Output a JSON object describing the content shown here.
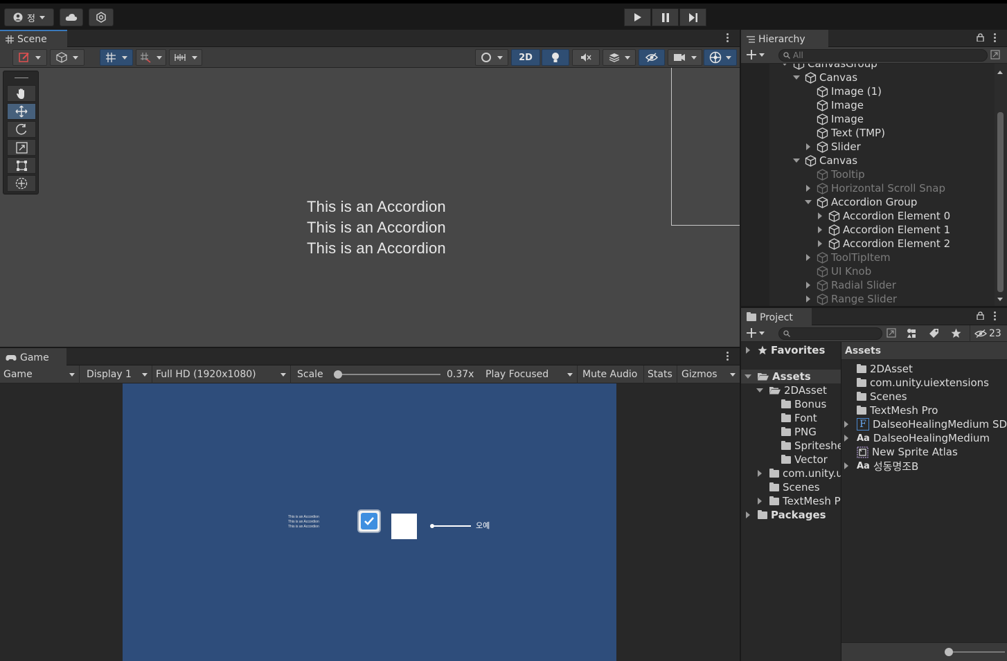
{
  "toolbar": {
    "account_label": "정",
    "icons": [
      "account-icon",
      "cloud-icon",
      "collab-icon",
      "play-icon",
      "pause-icon",
      "step-icon"
    ]
  },
  "scene": {
    "tab_label": "Scene",
    "toggle_2d": "2D",
    "accordion_lines": [
      "This is an Accordion",
      "This is an Accordion",
      "This is an Accordion"
    ]
  },
  "game": {
    "tab_label": "Game",
    "view_mode": "Game",
    "display": "Display 1",
    "resolution": "Full HD (1920x1080)",
    "scale_label": "Scale",
    "scale_value": "0.37x",
    "scale_fraction": 0.0,
    "play_mode": "Play Focused",
    "mute": "Mute Audio",
    "stats": "Stats",
    "gizmos": "Gizmos",
    "canvas": {
      "mini_lines": [
        "This is an Accordion",
        "This is an Accordion",
        "This is an Accordion"
      ],
      "slider_label": "오예",
      "toggle_checked": true
    }
  },
  "hierarchy": {
    "tab_label": "Hierarchy",
    "search_placeholder": "All",
    "items": [
      {
        "label": "CanvasGroup",
        "depth": 0,
        "arrow": "down",
        "dim": false
      },
      {
        "label": "Canvas",
        "depth": 1,
        "arrow": "down",
        "dim": false
      },
      {
        "label": "Image (1)",
        "depth": 2,
        "arrow": "",
        "dim": false
      },
      {
        "label": "Image",
        "depth": 2,
        "arrow": "",
        "dim": false
      },
      {
        "label": "Image",
        "depth": 2,
        "arrow": "",
        "dim": false
      },
      {
        "label": "Text (TMP)",
        "depth": 2,
        "arrow": "",
        "dim": false
      },
      {
        "label": "Slider",
        "depth": 2,
        "arrow": "right",
        "dim": false
      },
      {
        "label": "Canvas",
        "depth": 1,
        "arrow": "down",
        "dim": false
      },
      {
        "label": "Tooltip",
        "depth": 2,
        "arrow": "",
        "dim": true
      },
      {
        "label": "Horizontal Scroll Snap",
        "depth": 2,
        "arrow": "right",
        "dim": true
      },
      {
        "label": "Accordion Group",
        "depth": 2,
        "arrow": "down",
        "dim": false
      },
      {
        "label": "Accordion Element 0",
        "depth": 3,
        "arrow": "right",
        "dim": false
      },
      {
        "label": "Accordion Element 1",
        "depth": 3,
        "arrow": "right",
        "dim": false
      },
      {
        "label": "Accordion Element 2",
        "depth": 3,
        "arrow": "right",
        "dim": false
      },
      {
        "label": "ToolTipItem",
        "depth": 2,
        "arrow": "right",
        "dim": true
      },
      {
        "label": "UI Knob",
        "depth": 2,
        "arrow": "",
        "dim": true
      },
      {
        "label": "Radial Slider",
        "depth": 2,
        "arrow": "right",
        "dim": true
      },
      {
        "label": "Range Slider",
        "depth": 2,
        "arrow": "right",
        "dim": true
      }
    ]
  },
  "project": {
    "tab_label": "Project",
    "hidden_count": "23",
    "tree": [
      {
        "label": "Favorites",
        "depth": 0,
        "arrow": "right",
        "kind": "star",
        "bold": true
      },
      {
        "label": "Assets",
        "depth": 0,
        "arrow": "down",
        "kind": "folder-open",
        "bold": true,
        "selected": true
      },
      {
        "label": "2DAsset",
        "depth": 1,
        "arrow": "down",
        "kind": "folder-open",
        "bold": false
      },
      {
        "label": "Bonus",
        "depth": 2,
        "arrow": "",
        "kind": "folder",
        "bold": false
      },
      {
        "label": "Font",
        "depth": 2,
        "arrow": "",
        "kind": "folder",
        "bold": false
      },
      {
        "label": "PNG",
        "depth": 2,
        "arrow": "",
        "kind": "folder",
        "bold": false
      },
      {
        "label": "Spritesheet",
        "depth": 2,
        "arrow": "",
        "kind": "folder",
        "bold": false
      },
      {
        "label": "Vector",
        "depth": 2,
        "arrow": "",
        "kind": "folder",
        "bold": false
      },
      {
        "label": "com.unity.uiextensions",
        "depth": 1,
        "arrow": "right",
        "kind": "folder",
        "bold": false
      },
      {
        "label": "Scenes",
        "depth": 1,
        "arrow": "",
        "kind": "folder",
        "bold": false
      },
      {
        "label": "TextMesh Pro",
        "depth": 1,
        "arrow": "right",
        "kind": "folder",
        "bold": false
      },
      {
        "label": "Packages",
        "depth": 0,
        "arrow": "right",
        "kind": "folder",
        "bold": true
      }
    ],
    "assets_header": "Assets",
    "assets": [
      {
        "label": "2DAsset",
        "kind": "folder",
        "arrow": false
      },
      {
        "label": "com.unity.uiextensions",
        "kind": "folder",
        "arrow": false
      },
      {
        "label": "Scenes",
        "kind": "folder",
        "arrow": false
      },
      {
        "label": "TextMesh Pro",
        "kind": "folder",
        "arrow": false
      },
      {
        "label": "DalseoHealingMedium SDF",
        "kind": "font-asset",
        "arrow": true
      },
      {
        "label": "DalseoHealingMedium",
        "kind": "font",
        "arrow": true
      },
      {
        "label": "New Sprite Atlas",
        "kind": "sprite-atlas",
        "arrow": false
      },
      {
        "label": "성동명조B",
        "kind": "font",
        "arrow": true
      }
    ],
    "font_glyph": "Aa",
    "font_asset_glyph": "F"
  }
}
